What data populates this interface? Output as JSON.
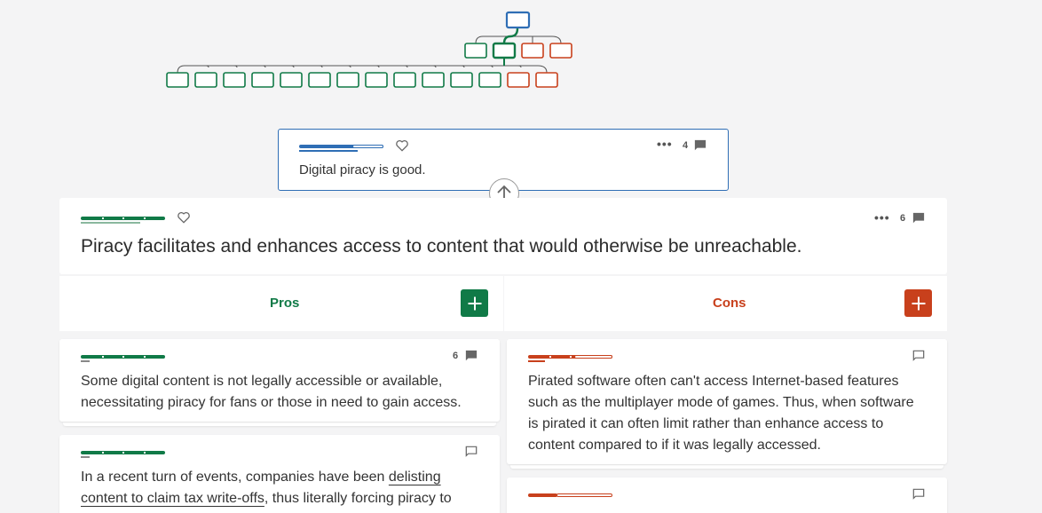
{
  "colors": {
    "pro": "#107a47",
    "con": "#c8401c",
    "parent": "#2f6eb5",
    "background": "#f4f4f5"
  },
  "tree": {
    "root_color": "parent",
    "level1": [
      "pro",
      "pro-selected",
      "con",
      "con"
    ],
    "level2": [
      "pro",
      "pro",
      "pro",
      "pro",
      "pro",
      "pro",
      "pro",
      "pro",
      "pro",
      "pro",
      "pro",
      "pro",
      "con",
      "con"
    ]
  },
  "parent_claim": {
    "text": "Digital piracy is good.",
    "comment_count": "4",
    "more_icon": "more-horizontal-icon",
    "heart_icon": "heart-outline-icon",
    "comment_icon": "comment-filled-icon"
  },
  "focus_claim": {
    "text": "Piracy facilitates and enhances access to content that would otherwise be unreachable.",
    "comment_count": "6"
  },
  "columns": {
    "pros_label": "Pros",
    "cons_label": "Cons"
  },
  "pros": [
    {
      "text": "Some digital content is not legally accessible or available, necessitating piracy for fans or those in need to gain access.",
      "comment_count": "6"
    },
    {
      "text_before": "In a recent turn of events, companies have been ",
      "link_text": "delisting content to claim tax write-offs",
      "text_after": ", thus literally forcing piracy to",
      "comment_count": ""
    }
  ],
  "cons": [
    {
      "text": "Pirated software often can't access Internet-based features such as the multiplayer mode of games. Thus, when software is pirated it can often limit rather than enhance access to content compared to if it was legally accessed.",
      "comment_count": ""
    }
  ]
}
